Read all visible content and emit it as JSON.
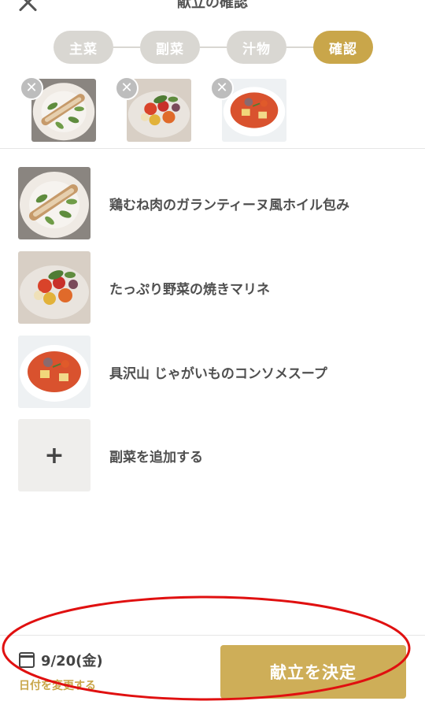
{
  "header": {
    "title": "献立の確認"
  },
  "steps": [
    {
      "label": "主菜",
      "active": false
    },
    {
      "label": "副菜",
      "active": false
    },
    {
      "label": "汁物",
      "active": false
    },
    {
      "label": "確認",
      "active": true
    }
  ],
  "selected": [
    {
      "dish": "chicken"
    },
    {
      "dish": "marinade"
    },
    {
      "dish": "soup"
    }
  ],
  "menu_items": [
    {
      "name": "鶏むね肉のガランティーヌ風ホイル包み",
      "dish": "chicken"
    },
    {
      "name": "たっぷり野菜の焼きマリネ",
      "dish": "marinade"
    },
    {
      "name": "具沢山 じゃがいものコンソメスープ",
      "dish": "soup"
    }
  ],
  "add_item": {
    "label": "副菜を追加する",
    "icon": "plus-icon"
  },
  "footer": {
    "date": "9/20(金)",
    "change_date": "日付を変更する",
    "decide": "献立を決定"
  },
  "colors": {
    "accent": "#c9a64a",
    "button": "#ceae58",
    "inactive_step": "#d9d7d2",
    "annotation": "#e01010"
  }
}
